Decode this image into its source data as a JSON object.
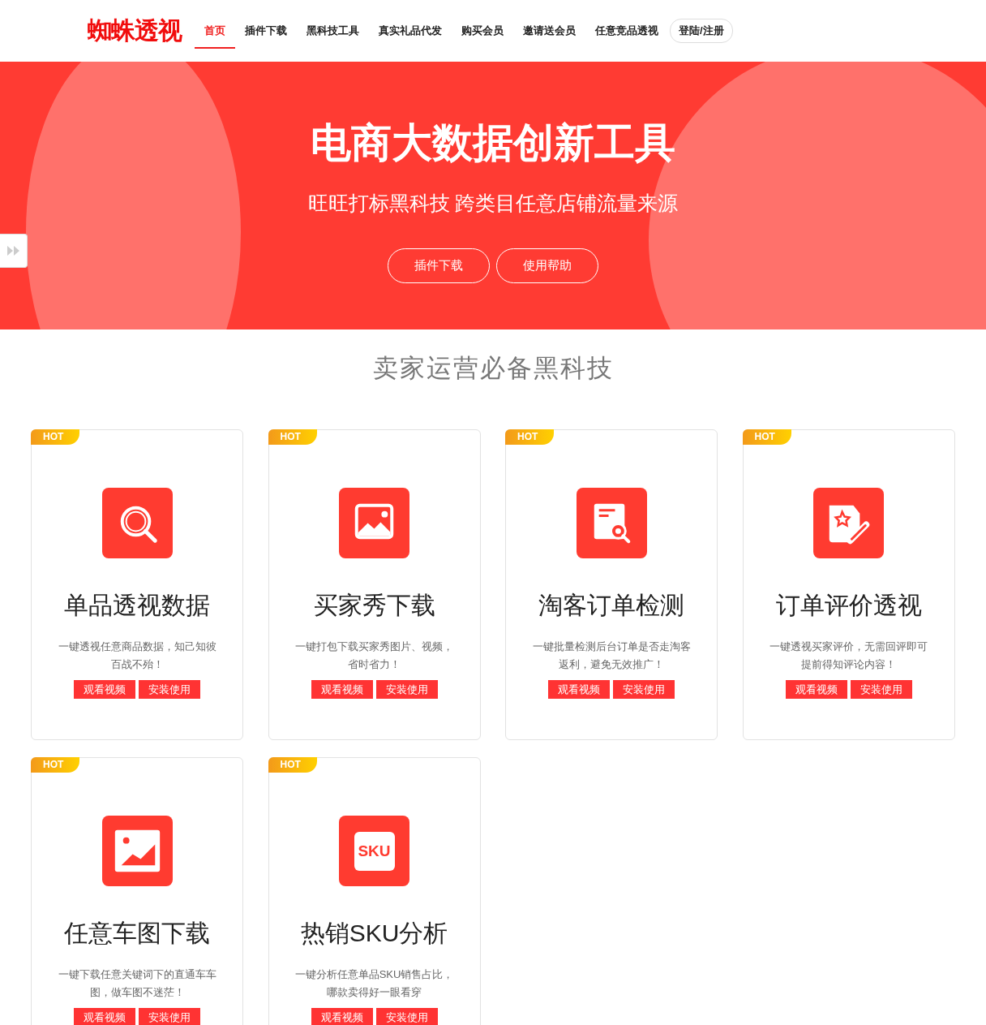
{
  "header": {
    "logo": "蜘蛛透视",
    "nav": [
      {
        "label": "首页",
        "selected": true
      },
      {
        "label": "插件下载",
        "selected": false
      },
      {
        "label": "黑科技工具",
        "selected": false
      },
      {
        "label": "真实礼品代发",
        "selected": false
      },
      {
        "label": "购买会员",
        "selected": false
      },
      {
        "label": "邀请送会员",
        "selected": false
      },
      {
        "label": "任意竞品透视",
        "selected": false
      }
    ],
    "login": "登陆/注册"
  },
  "hero": {
    "title": "电商大数据创新工具",
    "subtitle": "旺旺打标黑科技 跨类目任意店铺流量来源",
    "buttons": [
      "插件下载",
      "使用帮助"
    ]
  },
  "section": {
    "title": "卖家运营必备黑科技",
    "cards": [
      {
        "badge": "HOT",
        "kind": "search",
        "title": "单品透视数据",
        "desc": "一键透视任意商品数据，知己知彼百战不殆！",
        "buttons": [
          "观看视频",
          "安装使用"
        ]
      },
      {
        "badge": "HOT",
        "kind": "photo",
        "title": "买家秀下载",
        "desc": "一键打包下载买家秀图片、视频，省时省力！",
        "buttons": [
          "观看视频",
          "安装使用"
        ]
      },
      {
        "badge": "HOT",
        "kind": "doc-search",
        "title": "淘客订单检测",
        "desc": "一键批量检测后台订单是否走淘客返利，避免无效推广！",
        "buttons": [
          "观看视频",
          "安装使用"
        ]
      },
      {
        "badge": "HOT",
        "kind": "review",
        "title": "订单评价透视",
        "desc": "一键透视买家评价，无需回评即可提前得知评论内容！",
        "buttons": [
          "观看视频",
          "安装使用"
        ]
      },
      {
        "badge": "HOT",
        "kind": "chart-image",
        "title": "任意车图下载",
        "desc": "一键下载任意关键词下的直通车车图，做车图不迷茫！",
        "buttons": [
          "观看视频",
          "安装使用"
        ]
      },
      {
        "badge": "HOT",
        "kind": "sku",
        "icon_text": "SKU",
        "title": "热销SKU分析",
        "desc": "一键分析任意单品SKU销售占比，哪款卖得好一眼看穿",
        "buttons": [
          "观看视频",
          "安装使用"
        ]
      }
    ]
  }
}
